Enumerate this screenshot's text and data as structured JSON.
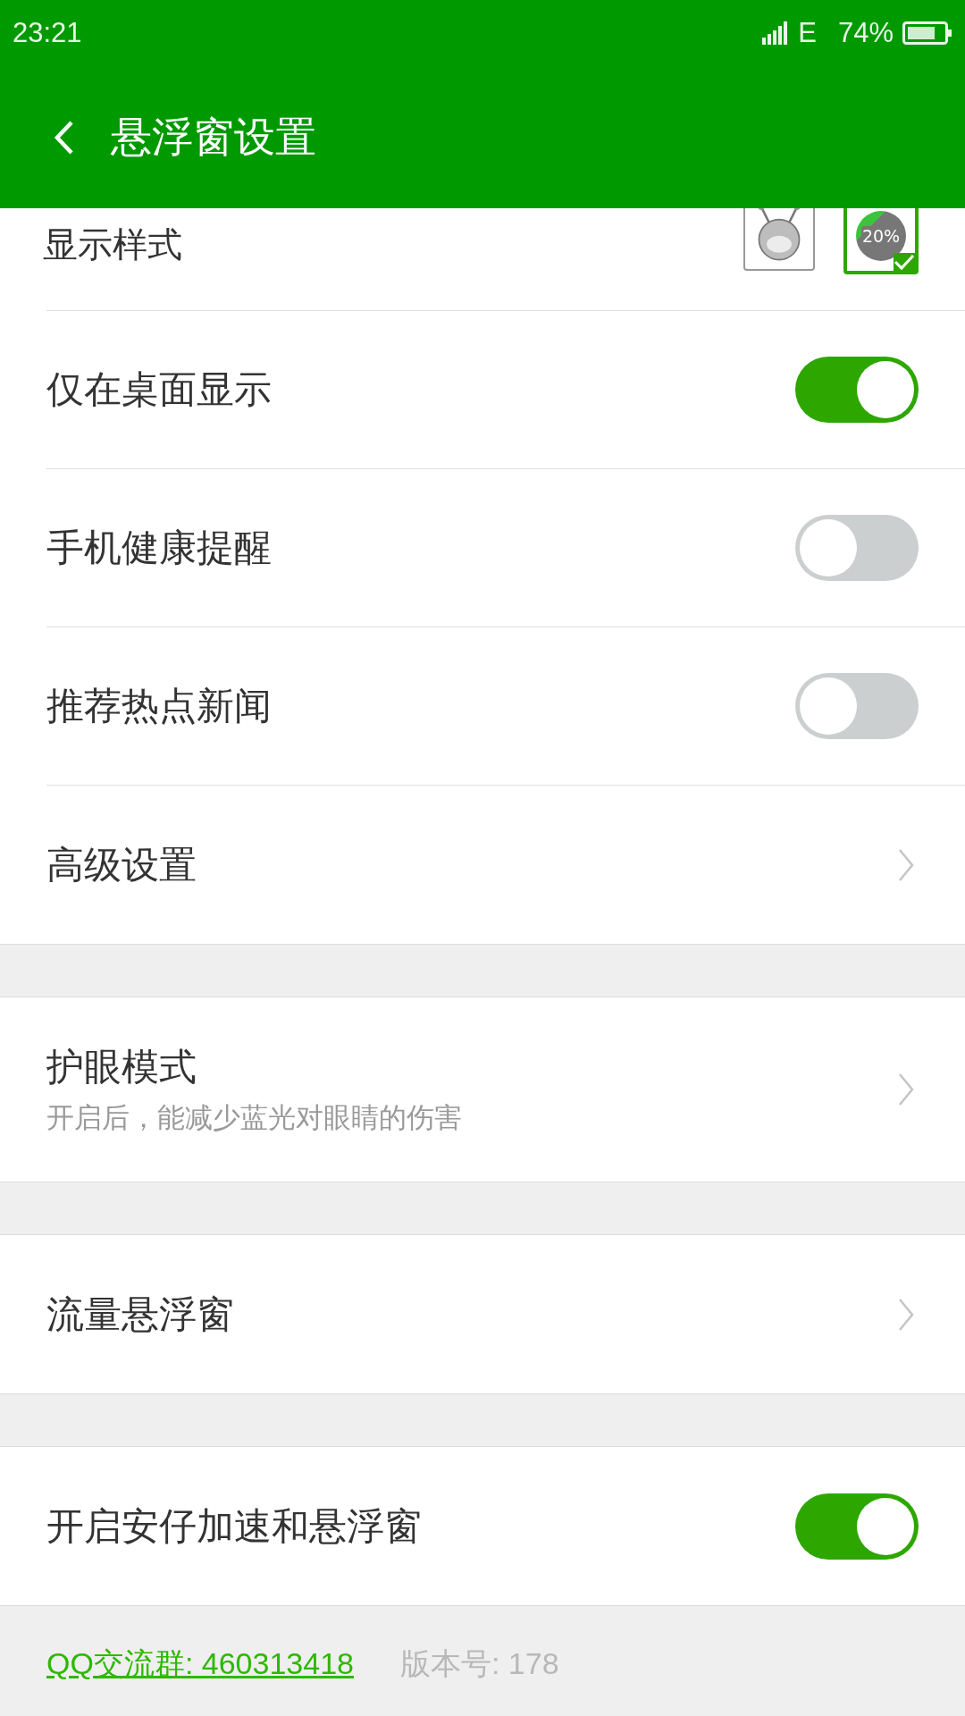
{
  "status_bar": {
    "time": "23:21",
    "network": "E",
    "battery": "74%"
  },
  "header": {
    "title": "悬浮窗设置"
  },
  "sections": [
    {
      "rows": [
        {
          "kind": "styles",
          "label": "显示样式",
          "options": [
            {
              "kind": "mascot",
              "selected": false
            },
            {
              "kind": "percent",
              "label": "20%",
              "selected": true
            }
          ]
        },
        {
          "kind": "switch",
          "label": "仅在桌面显示",
          "on": true
        },
        {
          "kind": "switch",
          "label": "手机健康提醒",
          "on": false
        },
        {
          "kind": "switch",
          "label": "推荐热点新闻",
          "on": false
        },
        {
          "kind": "link",
          "label": "高级设置"
        }
      ]
    },
    {
      "rows": [
        {
          "kind": "link",
          "label": "护眼模式",
          "subtitle": "开启后，能减少蓝光对眼睛的伤害"
        }
      ]
    },
    {
      "rows": [
        {
          "kind": "link",
          "label": "流量悬浮窗"
        }
      ]
    },
    {
      "rows": [
        {
          "kind": "switch",
          "label": "开启安仔加速和悬浮窗",
          "on": true
        }
      ]
    }
  ],
  "footer": {
    "qq_group": "QQ交流群: 460313418",
    "version": "版本号: 178"
  }
}
